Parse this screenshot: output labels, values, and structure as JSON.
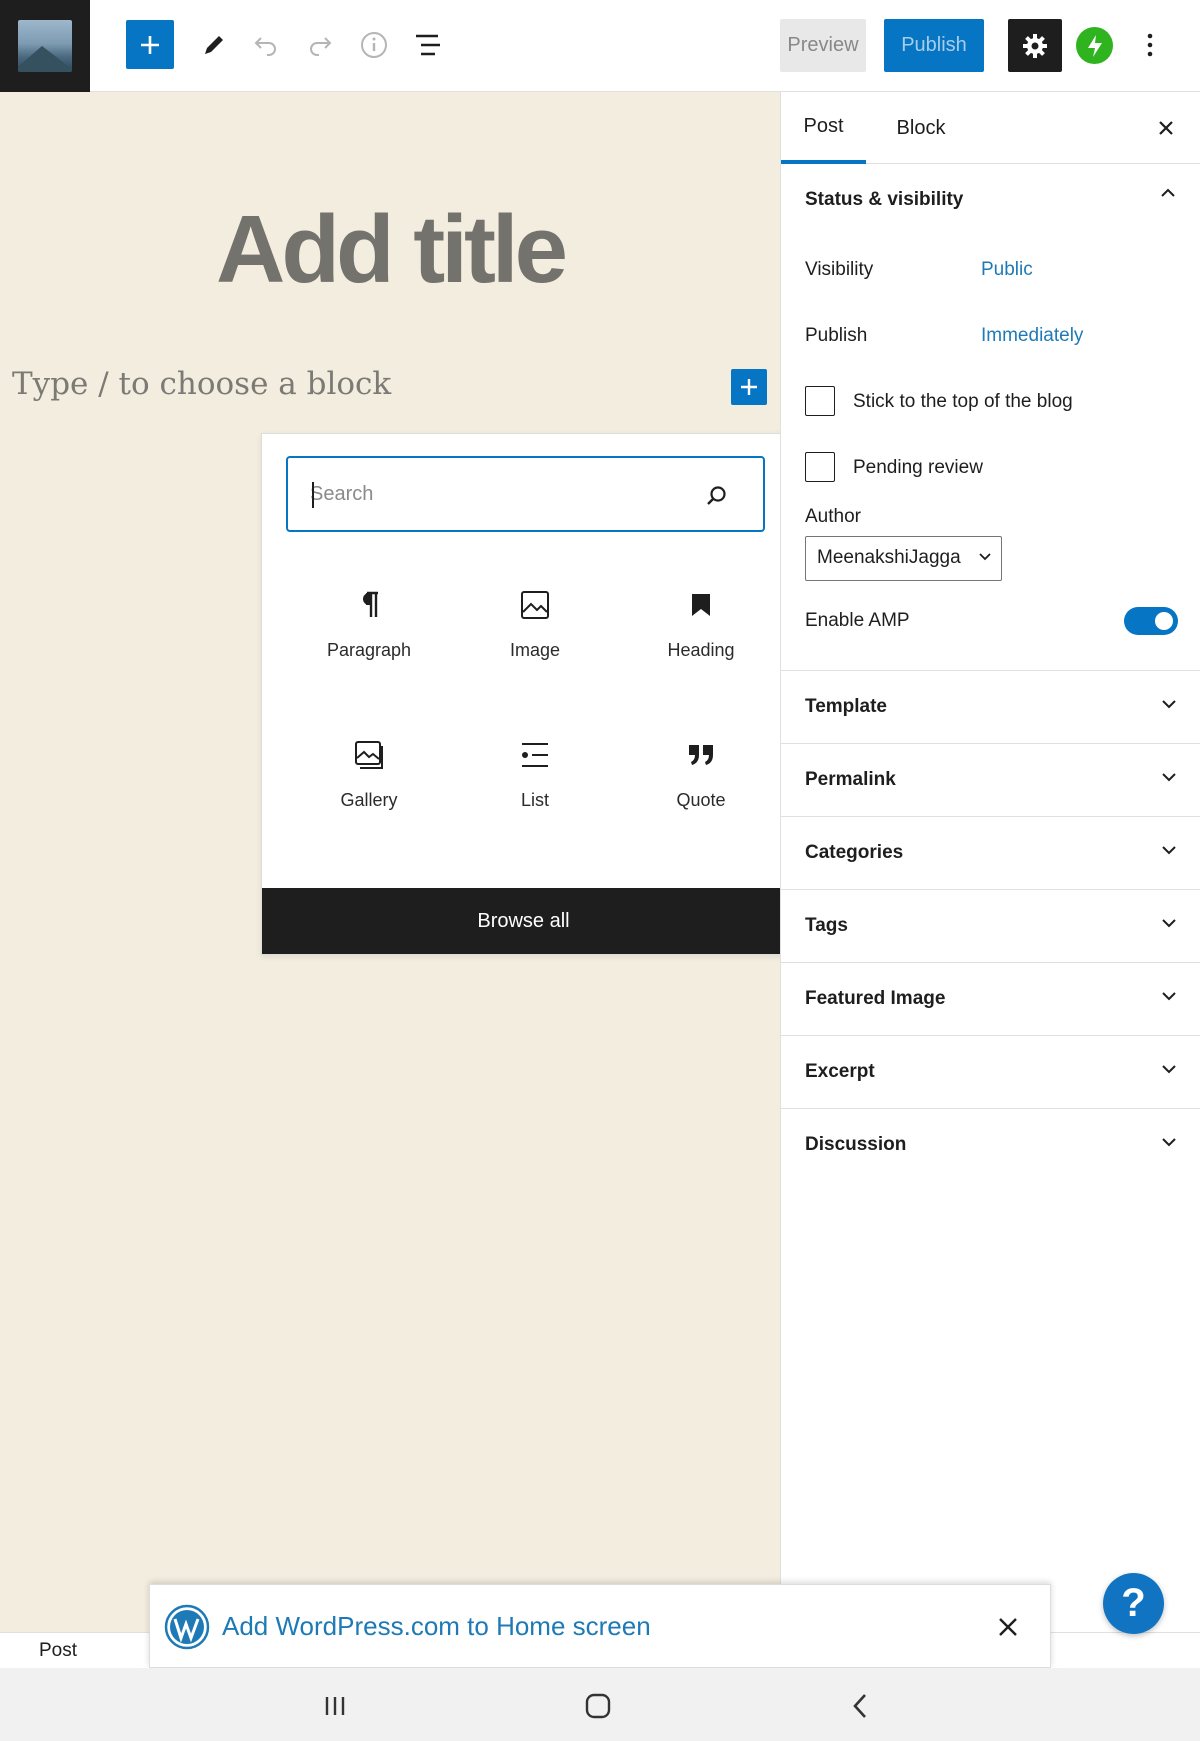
{
  "toolbar": {
    "site_icon": "mountain-landscape-thumbnail",
    "add_block_icon": "plus-icon",
    "tools_icon": "pencil-icon",
    "undo_icon": "undo-icon",
    "redo_icon": "redo-icon",
    "details_icon": "info-icon",
    "list_view_icon": "list-view-icon",
    "preview_label": "Preview",
    "publish_label": "Publish",
    "settings_icon": "gear-icon",
    "jetpack_icon": "jetpack-bolt-icon",
    "more_icon": "vertical-ellipsis-icon"
  },
  "editor": {
    "title_placeholder": "Add title",
    "block_placeholder": "Type / to choose a block"
  },
  "inserter": {
    "search_placeholder": "Search",
    "blocks": [
      {
        "label": "Paragraph",
        "icon": "paragraph-icon"
      },
      {
        "label": "Image",
        "icon": "image-icon"
      },
      {
        "label": "Heading",
        "icon": "heading-bookmark-icon"
      },
      {
        "label": "Gallery",
        "icon": "gallery-icon"
      },
      {
        "label": "List",
        "icon": "list-icon"
      },
      {
        "label": "Quote",
        "icon": "quote-icon"
      }
    ],
    "browse_all_label": "Browse all"
  },
  "sidebar": {
    "tabs": [
      {
        "label": "Post"
      },
      {
        "label": "Block"
      }
    ],
    "active_tab": "Post",
    "status_visibility": {
      "title": "Status & visibility",
      "visibility_label": "Visibility",
      "visibility_value": "Public",
      "publish_label": "Publish",
      "publish_value": "Immediately",
      "sticky_label": "Stick to the top of the blog",
      "sticky_checked": false,
      "pending_label": "Pending review",
      "pending_checked": false,
      "author_label": "Author",
      "author_value": "MeenakshiJagga",
      "amp_label": "Enable AMP",
      "amp_enabled": true
    },
    "panels": [
      {
        "title": "Template"
      },
      {
        "title": "Permalink"
      },
      {
        "title": "Categories"
      },
      {
        "title": "Tags"
      },
      {
        "title": "Featured Image"
      },
      {
        "title": "Excerpt"
      },
      {
        "title": "Discussion"
      }
    ]
  },
  "footer": {
    "breadcrumb": "Post"
  },
  "banner": {
    "text": "Add WordPress.com to Home screen"
  },
  "colors": {
    "accent": "#0675c4",
    "link": "#1e7ab6",
    "canvas": "#f2eddf",
    "jetpack": "#2fb41f"
  }
}
